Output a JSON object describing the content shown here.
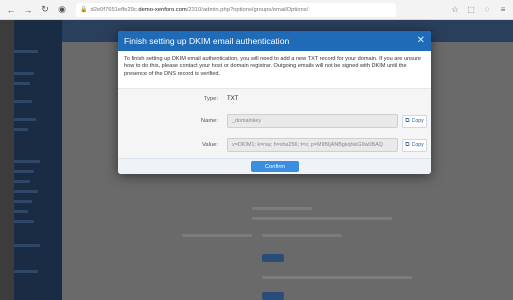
{
  "browser": {
    "url_prefix": "d2e0f7651effe29c.",
    "url_domain": "demo-xenforo.com",
    "url_path": "/2310/admin.php?options/groups/emailOptions/"
  },
  "modal": {
    "title": "Finish setting up DKIM email authentication",
    "description": "To finish setting up DKIM email authentication, you will need to add a new TXT record for your domain. If you are unsure how to do this, please contact your host or domain registrar. Outgoing emails will not be signed with DKIM until the presence of the DNS record is verified.",
    "fields": {
      "type_label": "Type:",
      "type_value": "TXT",
      "name_label": "Name:",
      "name_value": "_domainkey",
      "value_label": "Value:",
      "value_value": "v=DKIM1; k=rsa; h=sha256; t=s; p=MIIBIjANBgkqhkiG9w0BAQ"
    },
    "copy_label": "Copy",
    "confirm_label": "Confirm"
  },
  "colors": {
    "header": "#1f6bb8",
    "confirm": "#3b8de0"
  }
}
